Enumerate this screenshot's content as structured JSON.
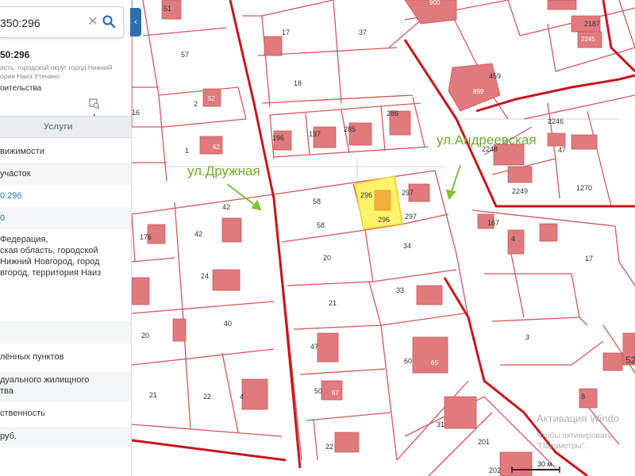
{
  "map": {
    "plots": [
      {
        "label": "51"
      },
      {
        "label": "57"
      },
      {
        "label": "17"
      },
      {
        "label": "37"
      },
      {
        "label": "18"
      },
      {
        "label": "52"
      },
      {
        "label": "2"
      },
      {
        "label": "16"
      },
      {
        "label": "62"
      },
      {
        "label": "1"
      },
      {
        "label": "196"
      },
      {
        "label": "197"
      },
      {
        "label": "285"
      },
      {
        "label": "286"
      },
      {
        "label": "900"
      },
      {
        "label": "459"
      },
      {
        "label": "899"
      },
      {
        "label": "2246"
      },
      {
        "label": "2187"
      },
      {
        "label": "2245"
      },
      {
        "label": "2248"
      },
      {
        "label": "47"
      },
      {
        "label": "2249"
      },
      {
        "label": "1270"
      },
      {
        "label": "296"
      },
      {
        "label": "58"
      },
      {
        "label": "58"
      },
      {
        "label": "297"
      },
      {
        "label": "297"
      },
      {
        "label": "296"
      },
      {
        "label": "42"
      },
      {
        "label": "42"
      },
      {
        "label": "176"
      },
      {
        "label": "20"
      },
      {
        "label": "34"
      },
      {
        "label": "24"
      },
      {
        "label": "33"
      },
      {
        "label": "21"
      },
      {
        "label": "40"
      },
      {
        "label": "20"
      },
      {
        "label": "47"
      },
      {
        "label": "60"
      },
      {
        "label": "65"
      },
      {
        "label": "21"
      },
      {
        "label": "22"
      },
      {
        "label": "4"
      },
      {
        "label": "50"
      },
      {
        "label": "67"
      },
      {
        "label": "31"
      },
      {
        "label": "201"
      },
      {
        "label": "22"
      },
      {
        "label": "167"
      },
      {
        "label": "4"
      },
      {
        "label": "17"
      },
      {
        "label": "3"
      },
      {
        "label": "8"
      },
      {
        "label": "202"
      },
      {
        "label": "52"
      }
    ],
    "streets": [
      "ул.Дружная",
      "ул.Андреевская"
    ],
    "scale_label": "30 м",
    "watermark": [
      "Активация Windo",
      "Чтобы активировать",
      "\"Параметры\"."
    ]
  },
  "panel": {
    "search": {
      "value": "350:296",
      "clear_icon": "close-icon",
      "search_icon": "search-icon"
    },
    "collapse_icon": "chevron-left-icon",
    "title": "50:296",
    "address": "асть, городской округ город Нижний\nория Наиз Утечино",
    "status": "оительства",
    "tab_services": "Услуги",
    "rows": [
      "вижимости",
      "участок",
      "0:296",
      "0",
      "Федерация,\nская область, городской\n Нижний Новгород, город\nвгород, территория Наиз",
      "",
      "лённых пунктов",
      "дуального жилищного\nтва",
      "ственность",
      "руб."
    ]
  },
  "colors": {
    "boundary": "#c8161d",
    "plot_line": "#d0575d",
    "building": "#e07a7c",
    "selected": "#fff36b",
    "selected_building": "#f2b13a",
    "street_label": "#6cab28",
    "link": "#2a6fb0"
  }
}
